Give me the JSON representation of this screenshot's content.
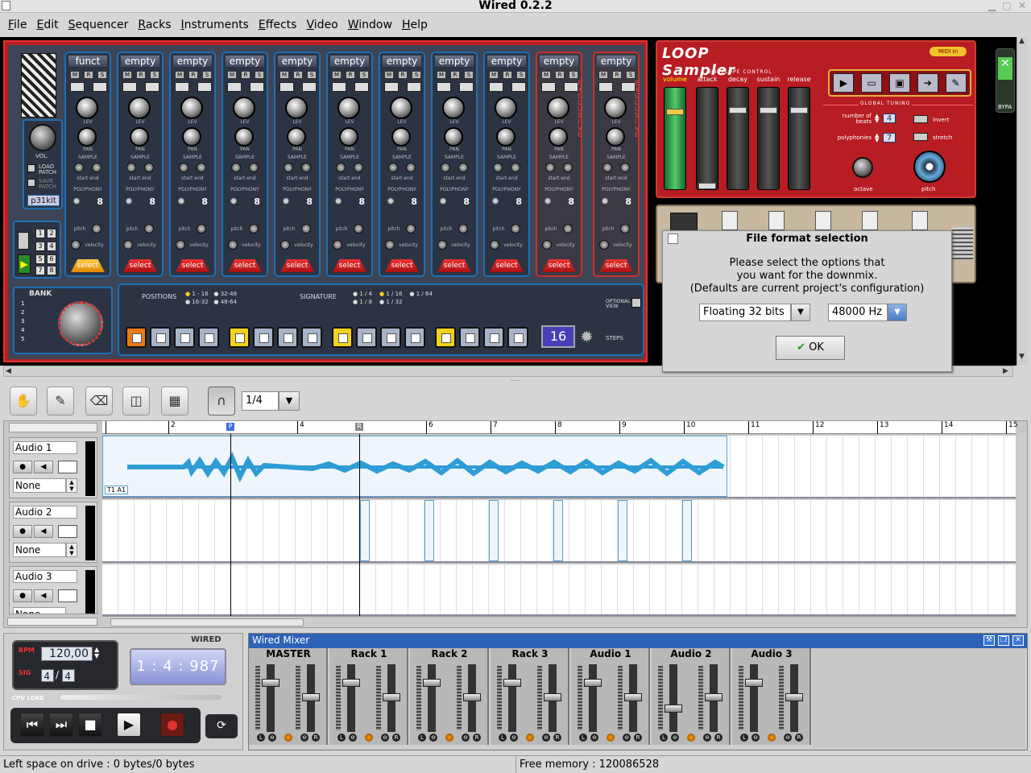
{
  "app": {
    "title": "Wired 0.2.2"
  },
  "menu": [
    "File",
    "Edit",
    "Sequencer",
    "Racks",
    "Instruments",
    "Effects",
    "Video",
    "Window",
    "Help"
  ],
  "drum": {
    "vol_label": "vol.",
    "load_patch": "LOAD PATCH",
    "save_patch": "SAVE PATCH",
    "kit_name": "p31kit",
    "bank_label": "BANK",
    "bank_numbers": [
      "1",
      "2",
      "3",
      "4",
      "5"
    ],
    "pattern_numbers": [
      "1",
      "2",
      "3",
      "4",
      "5",
      "6",
      "7",
      "8"
    ],
    "channels": [
      {
        "name": "funct",
        "polyphony": "8",
        "select": "select"
      },
      {
        "name": "empty",
        "polyphony": "8",
        "select": "select"
      },
      {
        "name": "empty",
        "polyphony": "8",
        "select": "select"
      },
      {
        "name": "empty",
        "polyphony": "8",
        "select": "select"
      },
      {
        "name": "empty",
        "polyphony": "8",
        "select": "select"
      },
      {
        "name": "empty",
        "polyphony": "8",
        "select": "select"
      },
      {
        "name": "empty",
        "polyphony": "8",
        "select": "select"
      },
      {
        "name": "empty",
        "polyphony": "8",
        "select": "select"
      },
      {
        "name": "empty",
        "polyphony": "8",
        "select": "select"
      },
      {
        "name": "empty",
        "polyphony": "8",
        "select": "select"
      },
      {
        "name": "empty",
        "polyphony": "8",
        "select": "select"
      }
    ],
    "labels": {
      "lev": "LEV",
      "pan": "PAN",
      "sample": "SAMPLE",
      "start": "start",
      "end": "end",
      "polyphony": "POLYPHONY",
      "pitch": "pitch",
      "velocity": "velocity",
      "exclusive": "EXCLUSIVE",
      "m": "M",
      "r": "R",
      "s": "S"
    },
    "positions_label": "POSITIONS",
    "positions": [
      "1 - 16",
      "32-48",
      "16-32",
      "48-64"
    ],
    "signature_label": "SIGNATURE",
    "signatures": [
      "1 / 4",
      "1 / 16",
      "1 / 64",
      "1 / 8",
      "1 / 32"
    ],
    "optional_view": "optional view",
    "steps_value": "16",
    "steps_label": "STEPS"
  },
  "loop": {
    "logo": "LOOP Sampler",
    "midi_in": "MIDI In",
    "envelope_control": "ENVELOPE CONTROL",
    "sliders": [
      "volume",
      "attack",
      "decay",
      "sustain",
      "release"
    ],
    "global_tuning": "GLOBAL TUNING",
    "number_of_beats_label": "number of beats",
    "number_of_beats": "4",
    "polyphonies_label": "polyphonies",
    "polyphonies": "7",
    "invert": "invert",
    "stretch": "stretch",
    "octave": "octave",
    "pitch": "pitch"
  },
  "bypass_label": "BYPA",
  "dialog": {
    "title": "File format selection",
    "line1": "Please select the options that",
    "line2": "you want for the downmix.",
    "line3": "(Defaults are current project's configuration)",
    "format": "Floating 32 bits",
    "rate": "48000 Hz",
    "ok": "OK"
  },
  "toolbar": {
    "quantize": "1/4"
  },
  "ruler": [
    "2",
    "4",
    "6",
    "7",
    "8",
    "9",
    "10",
    "11",
    "12",
    "13",
    "14",
    "15"
  ],
  "markers": {
    "p": "P",
    "r": "R"
  },
  "tracks": [
    {
      "name": "Audio 1",
      "route": "None",
      "clip_label": "T1 A1"
    },
    {
      "name": "Audio 2",
      "route": "None"
    },
    {
      "name": "Audio 3",
      "route": "None"
    }
  ],
  "transport": {
    "bpm_label": "BPM",
    "bpm": "120,00",
    "sig_label": "SIG",
    "sig_num": "4",
    "sig_den": "4",
    "time": "1 : 4 : 987",
    "logo": "WIRED",
    "cpu_label": "CPU LOAD"
  },
  "mixer": {
    "title": "Wired Mixer",
    "strips": [
      "MASTER",
      "Rack 1",
      "Rack 2",
      "Rack 3",
      "Audio 1",
      "Audio 2",
      "Audio 3"
    ],
    "l": "L",
    "r": "R"
  },
  "status": {
    "left": "Left space on drive : 0 bytes/0 bytes",
    "right": "Free memory : 120086528"
  }
}
